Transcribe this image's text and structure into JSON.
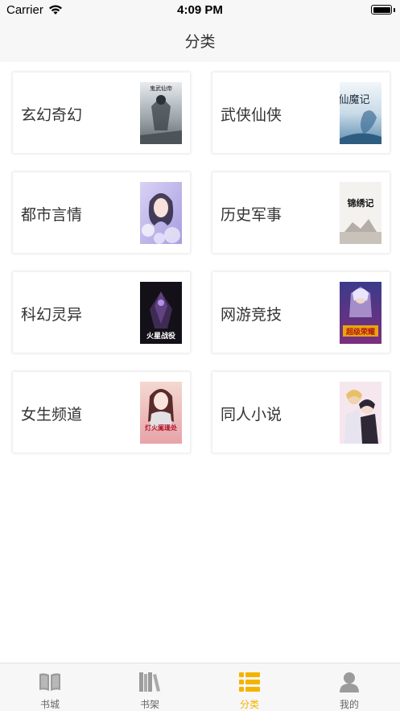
{
  "status_bar": {
    "carrier": "Carrier",
    "time": "4:09 PM"
  },
  "nav": {
    "title": "分类"
  },
  "categories": [
    {
      "label": "玄幻奇幻",
      "cover_text": "鬼武仙帝",
      "cover_icon": "book-cover-icon"
    },
    {
      "label": "武侠仙侠",
      "cover_text": "仙魔记",
      "cover_icon": "book-cover-icon"
    },
    {
      "label": "都市言情",
      "cover_text": "",
      "cover_icon": "book-cover-icon"
    },
    {
      "label": "历史军事",
      "cover_text": "锦绣记",
      "cover_icon": "book-cover-icon"
    },
    {
      "label": "科幻灵异",
      "cover_text": "火星战役",
      "cover_icon": "book-cover-icon"
    },
    {
      "label": "网游竞技",
      "cover_text": "超级荣耀",
      "cover_icon": "book-cover-icon"
    },
    {
      "label": "女生频道",
      "cover_text": "灯火阑珊处",
      "cover_icon": "book-cover-icon"
    },
    {
      "label": "同人小说",
      "cover_text": "",
      "cover_icon": "book-cover-icon"
    }
  ],
  "tab_bar": {
    "tabs": [
      {
        "label": "书城",
        "icon": "open-book-icon",
        "active": false
      },
      {
        "label": "书架",
        "icon": "bookshelf-icon",
        "active": false
      },
      {
        "label": "分类",
        "icon": "list-icon",
        "active": true
      },
      {
        "label": "我的",
        "icon": "person-icon",
        "active": false
      }
    ],
    "active_color": "#f5b300",
    "inactive_color": "#9b9b9b"
  }
}
